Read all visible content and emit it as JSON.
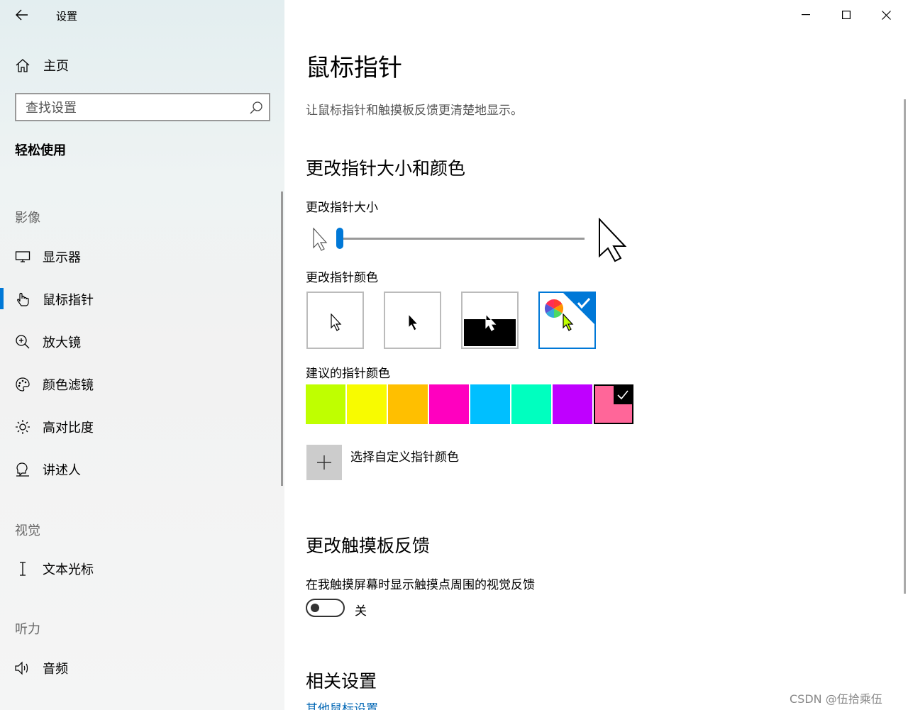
{
  "app": {
    "title": "设置"
  },
  "sidebar": {
    "home_label": "主页",
    "search_placeholder": "查找设置",
    "section": "轻松使用",
    "groups": [
      {
        "title": "影像",
        "items": [
          "显示器",
          "鼠标指针",
          "放大镜",
          "颜色滤镜",
          "高对比度",
          "讲述人"
        ]
      },
      {
        "title": "视觉",
        "items": [
          "文本光标"
        ]
      },
      {
        "title": "听力",
        "items": [
          "音频"
        ]
      }
    ],
    "active_item": "鼠标指针"
  },
  "main": {
    "title": "鼠标指针",
    "description": "让鼠标指针和触摸板反馈更清楚地显示。",
    "size_color_heading": "更改指针大小和颜色",
    "size_label": "更改指针大小",
    "size_value": 1,
    "color_label": "更改指针颜色",
    "color_options": [
      "white",
      "black",
      "inverted",
      "custom"
    ],
    "selected_color_option": "custom",
    "suggested_label": "建议的指针颜色",
    "suggested_colors": [
      "#bfff00",
      "#f8fb00",
      "#ffbf00",
      "#ff00bf",
      "#00bfff",
      "#00ffbf",
      "#bf00ff",
      "#ff6699"
    ],
    "selected_suggested_color": "#ff6699",
    "custom_color_label": "选择自定义指针颜色",
    "touch_heading": "更改触摸板反馈",
    "touch_label": "在我触摸屏幕时显示触摸点周围的视觉反馈",
    "touch_toggle_state": "关",
    "related_heading": "相关设置",
    "related_link": "其他鼠标设置"
  },
  "watermark": "CSDN @伍拾乘伍",
  "colors": {
    "accent": "#0078d7",
    "link": "#0066b4"
  }
}
